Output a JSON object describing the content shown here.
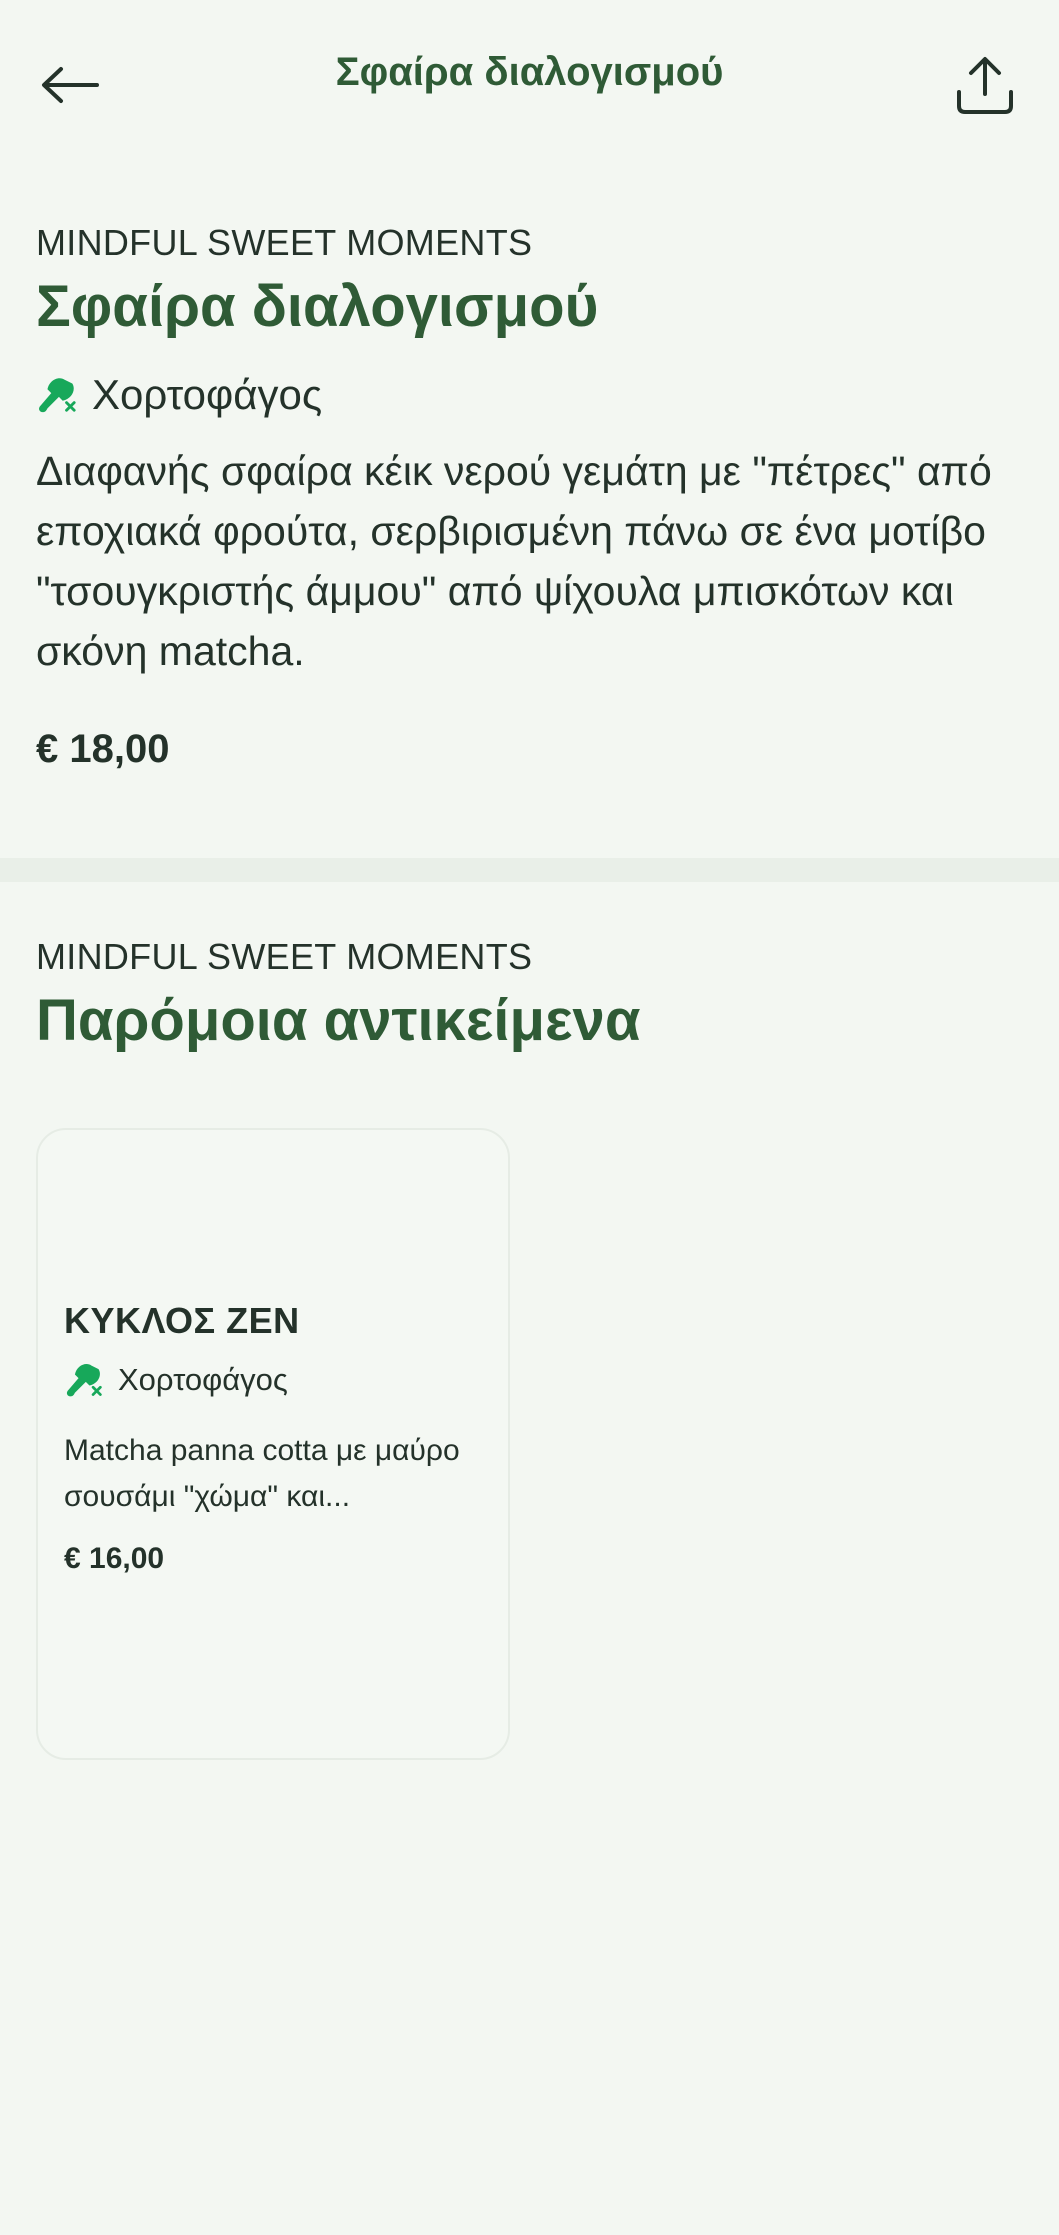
{
  "header": {
    "title": "Σφαίρα διαλογισμού",
    "back_icon": "arrow-left-icon",
    "share_icon": "share-icon"
  },
  "item": {
    "category": "MINDFUL SWEET MOMENTS",
    "title": "Σφαίρα διαλογισμού",
    "diet_icon": "vegetarian-icon",
    "diet_label": "Χορτοφάγος",
    "description": "Διαφανής σφαίρα κέικ νερού γεμάτη με \"πέτρες\" από εποχιακά φρούτα, σερβιρισμένη πάνω σε ένα μοτίβο \"τσουγκριστής άμμου\" από ψίχουλα μπισκότων και σκόνη matcha.",
    "price": "€ 18,00"
  },
  "similar": {
    "category": "MINDFUL SWEET MOMENTS",
    "heading": "Παρόμοια αντικείμενα",
    "items": [
      {
        "title": "ΚΥΚΛΟΣ ΖΕΝ",
        "diet_label": "Χορτοφάγος",
        "description": "Matcha panna cotta με μαύρο σουσάμι \"χώμα\" και...",
        "price": "€ 16,00"
      }
    ]
  },
  "colors": {
    "background": "#f3f7f2",
    "accent_green": "#2f5b36",
    "icon_green": "#17a85a",
    "text": "#24322a"
  }
}
